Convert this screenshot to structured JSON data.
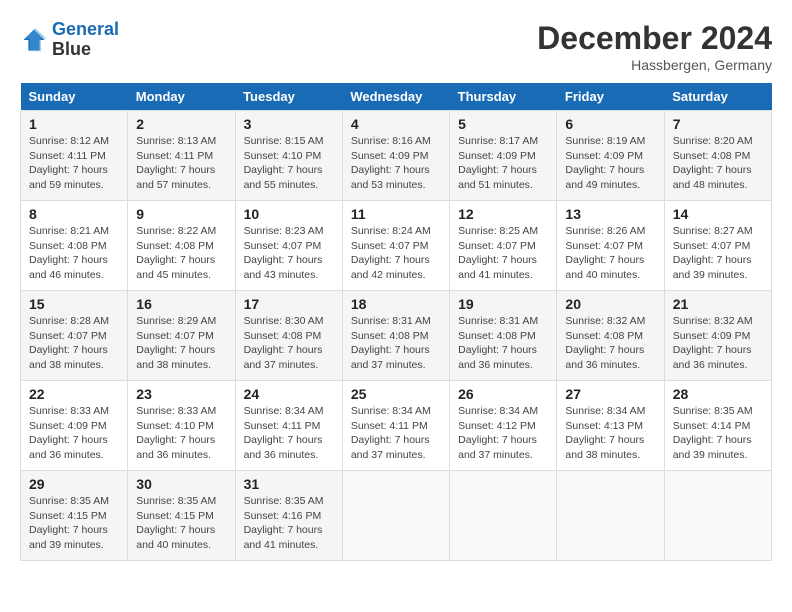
{
  "header": {
    "logo_line1": "General",
    "logo_line2": "Blue",
    "month_title": "December 2024",
    "location": "Hassbergen, Germany"
  },
  "weekdays": [
    "Sunday",
    "Monday",
    "Tuesday",
    "Wednesday",
    "Thursday",
    "Friday",
    "Saturday"
  ],
  "weeks": [
    [
      {
        "day": "1",
        "sunrise": "8:12 AM",
        "sunset": "4:11 PM",
        "daylight": "7 hours and 59 minutes."
      },
      {
        "day": "2",
        "sunrise": "8:13 AM",
        "sunset": "4:11 PM",
        "daylight": "7 hours and 57 minutes."
      },
      {
        "day": "3",
        "sunrise": "8:15 AM",
        "sunset": "4:10 PM",
        "daylight": "7 hours and 55 minutes."
      },
      {
        "day": "4",
        "sunrise": "8:16 AM",
        "sunset": "4:09 PM",
        "daylight": "7 hours and 53 minutes."
      },
      {
        "day": "5",
        "sunrise": "8:17 AM",
        "sunset": "4:09 PM",
        "daylight": "7 hours and 51 minutes."
      },
      {
        "day": "6",
        "sunrise": "8:19 AM",
        "sunset": "4:09 PM",
        "daylight": "7 hours and 49 minutes."
      },
      {
        "day": "7",
        "sunrise": "8:20 AM",
        "sunset": "4:08 PM",
        "daylight": "7 hours and 48 minutes."
      }
    ],
    [
      {
        "day": "8",
        "sunrise": "8:21 AM",
        "sunset": "4:08 PM",
        "daylight": "7 hours and 46 minutes."
      },
      {
        "day": "9",
        "sunrise": "8:22 AM",
        "sunset": "4:08 PM",
        "daylight": "7 hours and 45 minutes."
      },
      {
        "day": "10",
        "sunrise": "8:23 AM",
        "sunset": "4:07 PM",
        "daylight": "7 hours and 43 minutes."
      },
      {
        "day": "11",
        "sunrise": "8:24 AM",
        "sunset": "4:07 PM",
        "daylight": "7 hours and 42 minutes."
      },
      {
        "day": "12",
        "sunrise": "8:25 AM",
        "sunset": "4:07 PM",
        "daylight": "7 hours and 41 minutes."
      },
      {
        "day": "13",
        "sunrise": "8:26 AM",
        "sunset": "4:07 PM",
        "daylight": "7 hours and 40 minutes."
      },
      {
        "day": "14",
        "sunrise": "8:27 AM",
        "sunset": "4:07 PM",
        "daylight": "7 hours and 39 minutes."
      }
    ],
    [
      {
        "day": "15",
        "sunrise": "8:28 AM",
        "sunset": "4:07 PM",
        "daylight": "7 hours and 38 minutes."
      },
      {
        "day": "16",
        "sunrise": "8:29 AM",
        "sunset": "4:07 PM",
        "daylight": "7 hours and 38 minutes."
      },
      {
        "day": "17",
        "sunrise": "8:30 AM",
        "sunset": "4:08 PM",
        "daylight": "7 hours and 37 minutes."
      },
      {
        "day": "18",
        "sunrise": "8:31 AM",
        "sunset": "4:08 PM",
        "daylight": "7 hours and 37 minutes."
      },
      {
        "day": "19",
        "sunrise": "8:31 AM",
        "sunset": "4:08 PM",
        "daylight": "7 hours and 36 minutes."
      },
      {
        "day": "20",
        "sunrise": "8:32 AM",
        "sunset": "4:08 PM",
        "daylight": "7 hours and 36 minutes."
      },
      {
        "day": "21",
        "sunrise": "8:32 AM",
        "sunset": "4:09 PM",
        "daylight": "7 hours and 36 minutes."
      }
    ],
    [
      {
        "day": "22",
        "sunrise": "8:33 AM",
        "sunset": "4:09 PM",
        "daylight": "7 hours and 36 minutes."
      },
      {
        "day": "23",
        "sunrise": "8:33 AM",
        "sunset": "4:10 PM",
        "daylight": "7 hours and 36 minutes."
      },
      {
        "day": "24",
        "sunrise": "8:34 AM",
        "sunset": "4:11 PM",
        "daylight": "7 hours and 36 minutes."
      },
      {
        "day": "25",
        "sunrise": "8:34 AM",
        "sunset": "4:11 PM",
        "daylight": "7 hours and 37 minutes."
      },
      {
        "day": "26",
        "sunrise": "8:34 AM",
        "sunset": "4:12 PM",
        "daylight": "7 hours and 37 minutes."
      },
      {
        "day": "27",
        "sunrise": "8:34 AM",
        "sunset": "4:13 PM",
        "daylight": "7 hours and 38 minutes."
      },
      {
        "day": "28",
        "sunrise": "8:35 AM",
        "sunset": "4:14 PM",
        "daylight": "7 hours and 39 minutes."
      }
    ],
    [
      {
        "day": "29",
        "sunrise": "8:35 AM",
        "sunset": "4:15 PM",
        "daylight": "7 hours and 39 minutes."
      },
      {
        "day": "30",
        "sunrise": "8:35 AM",
        "sunset": "4:15 PM",
        "daylight": "7 hours and 40 minutes."
      },
      {
        "day": "31",
        "sunrise": "8:35 AM",
        "sunset": "4:16 PM",
        "daylight": "7 hours and 41 minutes."
      },
      null,
      null,
      null,
      null
    ]
  ],
  "labels": {
    "sunrise": "Sunrise:",
    "sunset": "Sunset:",
    "daylight": "Daylight:"
  }
}
